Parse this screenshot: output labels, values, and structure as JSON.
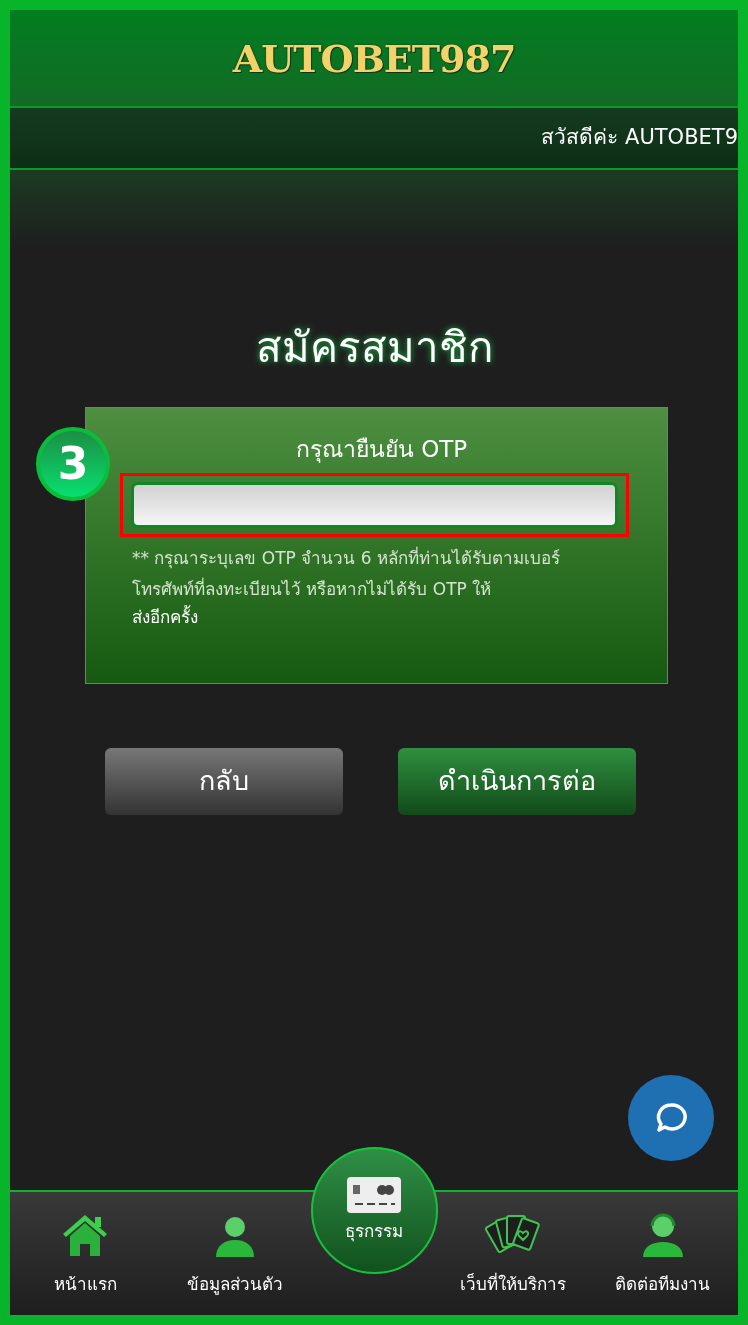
{
  "header": {
    "logo": "AUTOBET987"
  },
  "marquee": {
    "text": "สวัสดีค่ะ AUTOBET9"
  },
  "page_title": "สมัครสมาชิก",
  "otp_card": {
    "step_badge": "3",
    "label": "กรุณายืนยัน OTP",
    "highlighted": true,
    "note": "** กรุณาระบุเลข OTP จำนวน 6 หลักที่ท่านได้รับตามเบอร์โทรศัพท์ที่ลงทะเบียนไว้ หรือหากไม่ได้รับ OTP ให้",
    "note_end": "ส่งอีกครั้ง"
  },
  "buttons": [
    {
      "label": "กลับ",
      "kind": "back"
    },
    {
      "label": "ดำเนินการต่อ",
      "kind": "next"
    }
  ],
  "bottom_nav": [
    {
      "label": "หน้าแรก",
      "kind": "standard"
    },
    {
      "label": "ข้อมูลส่วนตัว",
      "kind": "standard"
    },
    {
      "label": "ธุรกรรม",
      "kind": "featured"
    },
    {
      "label": "เว็บที่ให้บริการ",
      "kind": "standard"
    },
    {
      "label": "ติดต่อทีมงาน",
      "kind": "standard"
    }
  ]
}
